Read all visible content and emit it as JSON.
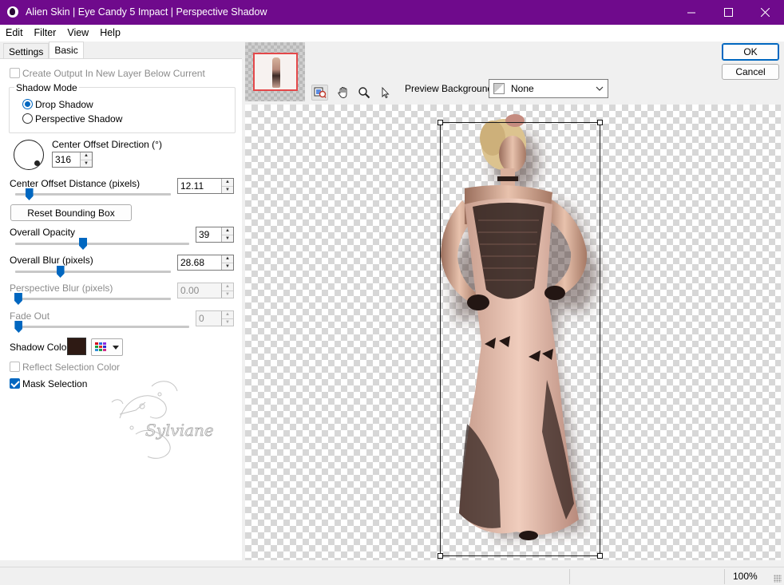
{
  "window": {
    "title": "Alien Skin | Eye Candy 5 Impact | Perspective Shadow",
    "min_icon": "minimize-icon",
    "max_icon": "maximize-icon",
    "close_icon": "close-icon",
    "title_color": "#6f0a8c"
  },
  "menu": [
    "Edit",
    "Filter",
    "View",
    "Help"
  ],
  "tabs": {
    "settings": "Settings",
    "basic": "Basic"
  },
  "panel": {
    "create_output_label": "Create Output In New Layer Below Current",
    "shadow_mode": {
      "title": "Shadow Mode",
      "drop_shadow": "Drop Shadow",
      "perspective_shadow": "Perspective Shadow",
      "selected": "Drop Shadow"
    },
    "center_offset_direction": {
      "label": "Center Offset Direction (°)",
      "value": "316"
    },
    "center_offset_distance": {
      "label": "Center Offset Distance (pixels)",
      "value": "12.11",
      "level": 0.09
    },
    "reset_bounding_box": "Reset Bounding Box",
    "overall_opacity": {
      "label": "Overall Opacity",
      "value": "39",
      "level": 0.39
    },
    "overall_blur": {
      "label": "Overall Blur (pixels)",
      "value": "28.68",
      "level": 0.29
    },
    "perspective_blur": {
      "label": "Perspective Blur (pixels)",
      "value": "0.00",
      "level": 0.02
    },
    "fade_out": {
      "label": "Fade Out",
      "value": "0",
      "level": 0.02
    },
    "shadow_color": {
      "label": "Shadow Color",
      "color": "#2e1a14"
    },
    "reflect_selection_color": "Reflect Selection Color",
    "mask_selection": "Mask Selection",
    "watermark_text": "Sylviane"
  },
  "buttons": {
    "ok": "OK",
    "cancel": "Cancel"
  },
  "tools": [
    "navigator-icon",
    "hand-icon",
    "zoom-icon",
    "pointer-icon"
  ],
  "preview_background": {
    "label": "Preview Background:",
    "value": "None"
  },
  "status": {
    "zoom": "100%"
  }
}
